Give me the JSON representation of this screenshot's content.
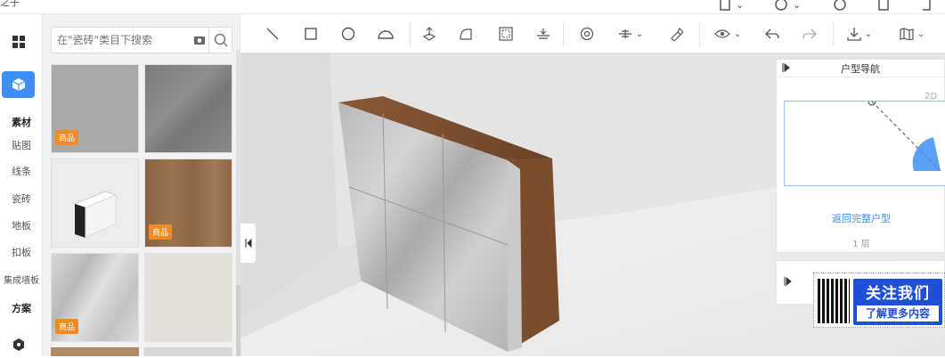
{
  "topbar": {
    "logo": "之子",
    "items": [
      {
        "icon": "book-icon",
        "caret": "⌄"
      },
      {
        "icon": "help-icon",
        "caret": "⌄"
      },
      {
        "icon": "clock-icon",
        "caret": ""
      },
      {
        "icon": "clipboard-icon",
        "caret": ""
      },
      {
        "icon": "exit-icon",
        "caret": ""
      }
    ]
  },
  "leftnav": {
    "section_material": "素材",
    "items": [
      "贴图",
      "线条",
      "瓷砖",
      "地板",
      "扣板",
      "集成墙板"
    ],
    "section_scheme": "方案"
  },
  "search": {
    "placeholder": "在\"瓷砖\"类目下搜索"
  },
  "tiles": [
    {
      "name": "gray-tile",
      "badge": "商品"
    },
    {
      "name": "marble-gray-tile",
      "badge": ""
    },
    {
      "name": "skirting-line",
      "badge": ""
    },
    {
      "name": "wood-floor",
      "badge": "商品"
    },
    {
      "name": "marble-white-tile",
      "badge": "商品"
    },
    {
      "name": "beige-tile",
      "badge": ""
    }
  ],
  "toolbar": {
    "tools": [
      "line-tool-icon",
      "rect-tool-icon",
      "circle-tool-icon",
      "arc-tool-icon",
      "lift-tool-icon",
      "bend-tool-icon",
      "frame-tool-icon",
      "level-tool-icon",
      "spiral-tool-icon",
      "align-tool-icon",
      "brush-tool-icon",
      "eye-tool-icon",
      "undo-icon",
      "redo-icon",
      "download-icon",
      "map-icon"
    ]
  },
  "nav": {
    "title": "户型导航",
    "tag_2d": "2D",
    "back_label": "返回完整户型",
    "floor_label": "1 层"
  },
  "promo": {
    "line1": "关注我们",
    "line2": "了解更多内容"
  },
  "colors": {
    "accent": "#3d8ff3",
    "badge": "#f08a24",
    "promo": "#1e4fd8"
  }
}
